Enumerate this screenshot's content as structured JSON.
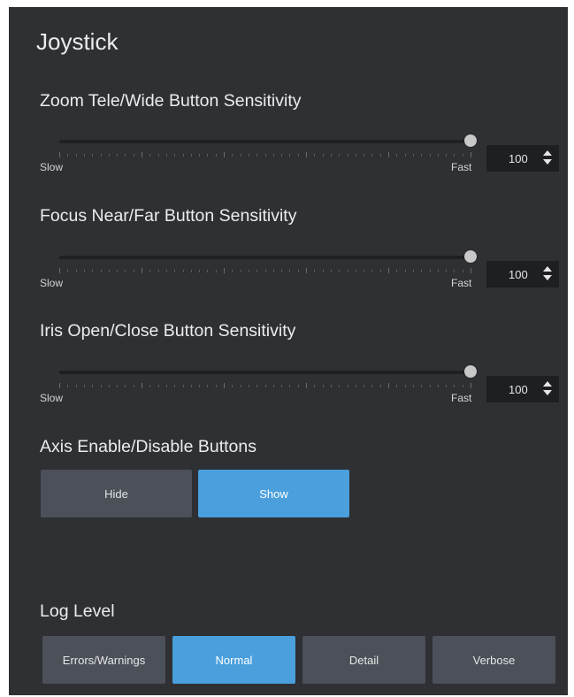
{
  "title": "Joystick",
  "sliders": [
    {
      "label": "Zoom Tele/Wide Button Sensitivity",
      "value": 100,
      "display": "100",
      "min_label": "Slow",
      "max_label": "Fast"
    },
    {
      "label": "Focus Near/Far Button Sensitivity",
      "value": 100,
      "display": "100",
      "min_label": "Slow",
      "max_label": "Fast"
    },
    {
      "label": "Iris Open/Close Button Sensitivity",
      "value": 100,
      "display": "100",
      "min_label": "Slow",
      "max_label": "Fast"
    }
  ],
  "axis": {
    "label": "Axis Enable/Disable Buttons",
    "options": [
      "Hide",
      "Show"
    ],
    "selected": "Show"
  },
  "log_level": {
    "label": "Log Level",
    "options": [
      "Errors/Warnings",
      "Normal",
      "Detail",
      "Verbose"
    ],
    "selected": "Normal"
  },
  "colors": {
    "panel_bg": "#2e3034",
    "button_off": "#4b5059",
    "button_on": "#4a9fdc",
    "spin_bg": "#1e1f22"
  }
}
